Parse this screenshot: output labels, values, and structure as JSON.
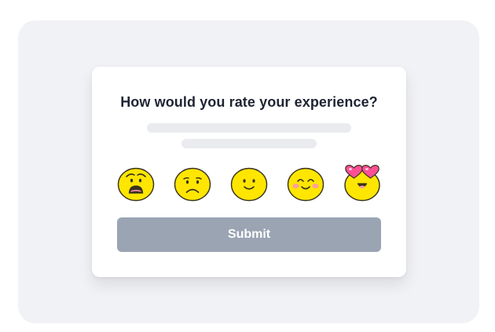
{
  "survey": {
    "question": "How would you rate your experience?",
    "submit_label": "Submit"
  },
  "rating_options": [
    {
      "icon": "worried-face-icon"
    },
    {
      "icon": "frowning-face-icon"
    },
    {
      "icon": "slightly-smiling-face-icon"
    },
    {
      "icon": "smiling-face-with-blush-icon"
    },
    {
      "icon": "heart-eyes-face-icon"
    }
  ],
  "colors": {
    "background_panel": "#f1f2f5",
    "card": "#ffffff",
    "emoji_face": "#ffe600",
    "emoji_outline": "#3a3220",
    "blush": "#ff8fb8",
    "heart": "#ff4f95",
    "submit_button": "#9aa4b3",
    "skeleton": "#e9ebee"
  }
}
